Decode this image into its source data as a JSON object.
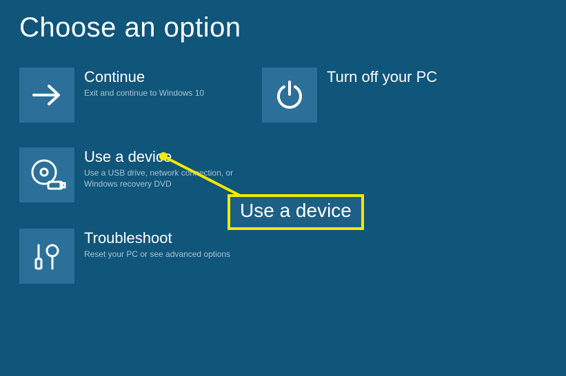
{
  "title": "Choose an option",
  "tiles": {
    "continue": {
      "title": "Continue",
      "sub": "Exit and continue to Windows 10"
    },
    "poweroff": {
      "title": "Turn off your PC",
      "sub": ""
    },
    "use_device": {
      "title": "Use a device",
      "sub": "Use a USB drive, network connection, or Windows recovery DVD"
    },
    "troubleshoot": {
      "title": "Troubleshoot",
      "sub": "Reset your PC or see advanced options"
    }
  },
  "callout": {
    "text": "Use a device"
  },
  "colors": {
    "bg": "#10557a",
    "tile": "#2b7099",
    "highlight": "#f5e900"
  }
}
